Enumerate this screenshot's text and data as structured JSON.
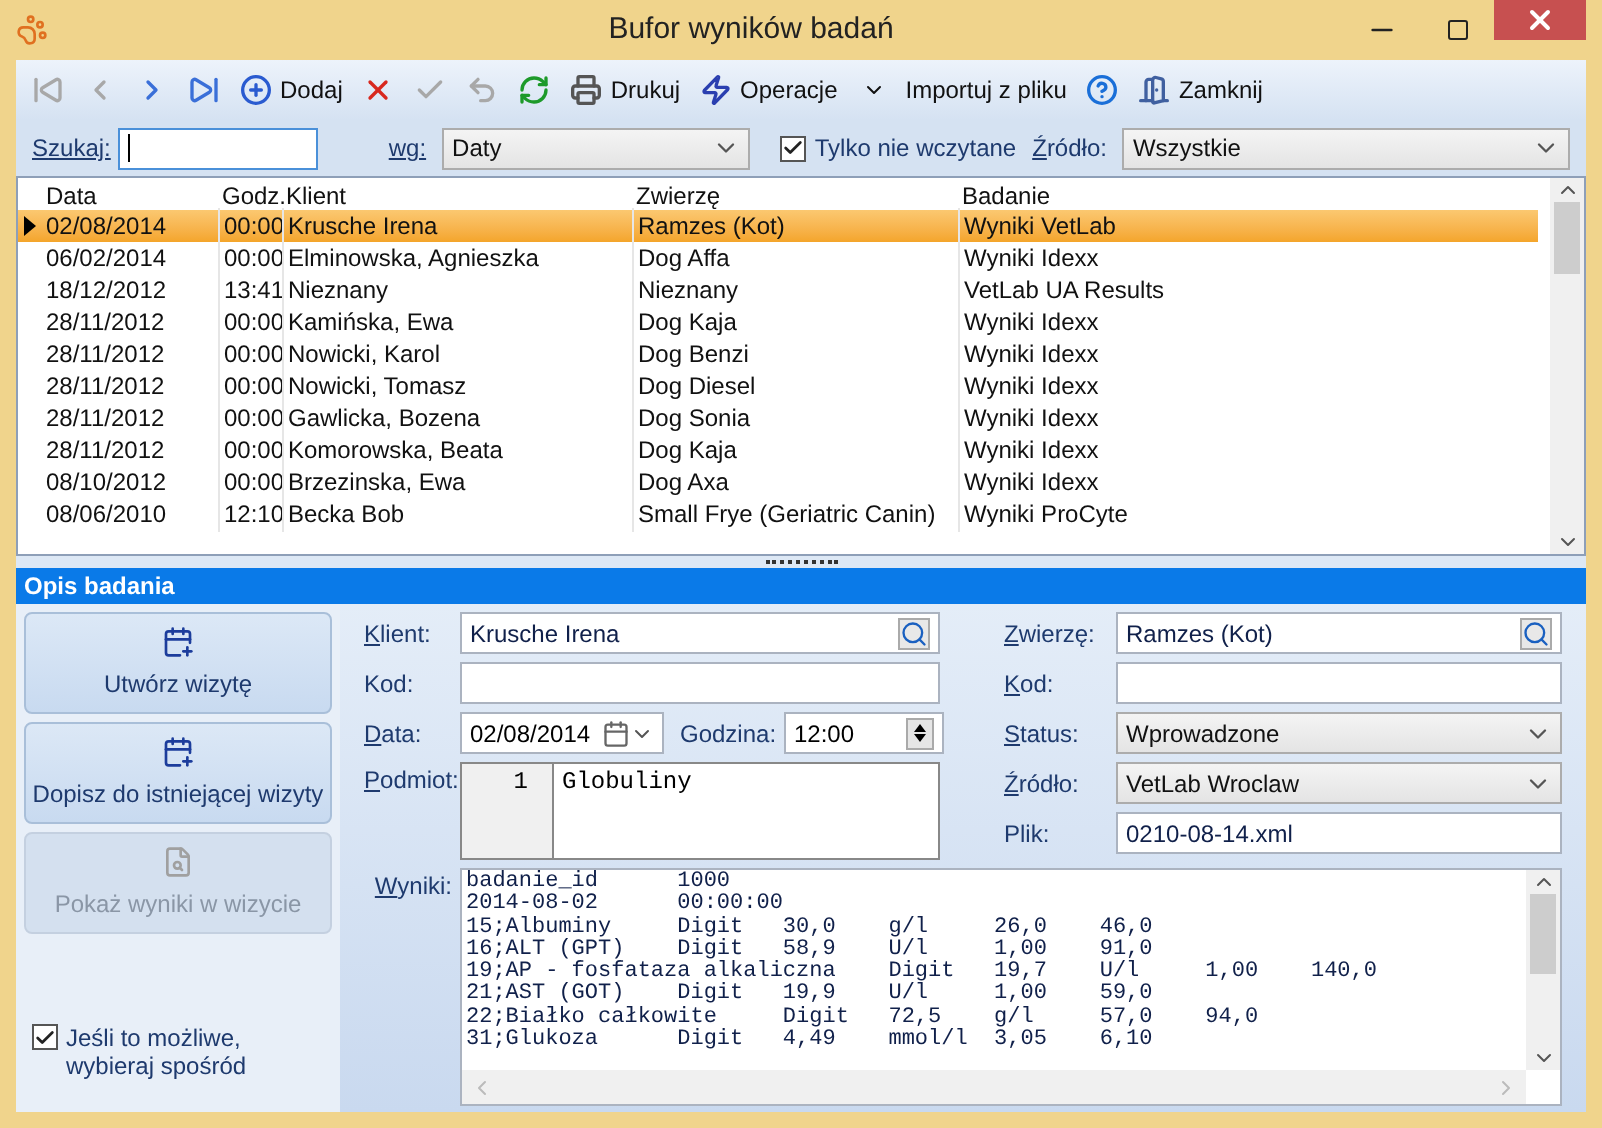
{
  "window": {
    "title": "Bufor wyników badań"
  },
  "toolbar": [
    {
      "kind": "first",
      "disabled": true
    },
    {
      "kind": "prev",
      "disabled": true
    },
    {
      "kind": "next",
      "disabled": false
    },
    {
      "kind": "last",
      "disabled": false
    },
    {
      "kind": "add",
      "label": "Dodaj",
      "disabled": false
    },
    {
      "kind": "delete",
      "disabled": false
    },
    {
      "kind": "accept",
      "disabled": true
    },
    {
      "kind": "undo",
      "disabled": true
    },
    {
      "kind": "refresh",
      "disabled": false
    },
    {
      "kind": "print",
      "label": "Drukuj",
      "disabled": false
    },
    {
      "kind": "operations",
      "label": "Operacje",
      "disabled": false
    },
    {
      "kind": "import",
      "label": "Importuj z pliku",
      "disabled": false
    },
    {
      "kind": "help",
      "disabled": false
    },
    {
      "kind": "close",
      "label": "Zamknij",
      "disabled": false
    }
  ],
  "filter": {
    "search_label": "Szukaj:",
    "by_label": "wg:",
    "by_value": "Daty",
    "only_new": {
      "label": "Tylko nie wczytane",
      "checked": true
    },
    "source_label": "Źródło:",
    "source_value": "Wszystkie"
  },
  "table": {
    "columns": [
      "Data",
      "Godz.",
      "Klient",
      "Zwierzę",
      "Badanie"
    ],
    "rows": [
      {
        "cells": [
          "02/08/2014",
          "00:00",
          "Krusche Irena",
          "Ramzes (Kot)",
          "Wyniki VetLab"
        ],
        "selected": true
      },
      {
        "cells": [
          "06/02/2014",
          "00:00",
          "Elminowska, Agnieszka",
          "Dog Affa",
          "Wyniki Idexx"
        ],
        "selected": false
      },
      {
        "cells": [
          "18/12/2012",
          "13:41",
          "Nieznany",
          "Nieznany",
          "VetLab UA Results"
        ],
        "selected": false
      },
      {
        "cells": [
          "28/11/2012",
          "00:00",
          "Kamińska, Ewa",
          "Dog Kaja",
          "Wyniki Idexx"
        ],
        "selected": false
      },
      {
        "cells": [
          "28/11/2012",
          "00:00",
          "Nowicki, Karol",
          "Dog Benzi",
          "Wyniki Idexx"
        ],
        "selected": false
      },
      {
        "cells": [
          "28/11/2012",
          "00:00",
          "Nowicki, Tomasz",
          "Dog Diesel",
          "Wyniki Idexx"
        ],
        "selected": false
      },
      {
        "cells": [
          "28/11/2012",
          "00:00",
          "Gawlicka, Bozena",
          "Dog Sonia",
          "Wyniki Idexx"
        ],
        "selected": false
      },
      {
        "cells": [
          "28/11/2012",
          "00:00",
          "Komorowska, Beata",
          "Dog Kaja",
          "Wyniki Idexx"
        ],
        "selected": false
      },
      {
        "cells": [
          "08/10/2012",
          "00:00",
          "Brzezinska, Ewa",
          "Dog Axa",
          "Wyniki Idexx"
        ],
        "selected": false
      },
      {
        "cells": [
          "08/06/2010",
          "12:10",
          "Becka Bob",
          "Small Frye (Geriatric Canin)",
          "Wyniki ProCyte"
        ],
        "selected": false
      }
    ]
  },
  "details": {
    "title": "Opis badania",
    "actions": [
      {
        "label": "Utwórz wizytę",
        "disabled": false
      },
      {
        "label": "Dopisz do istniejącej wizyty",
        "disabled": false
      },
      {
        "label": "Pokaż wyniki w wizycie",
        "disabled": true
      }
    ],
    "prefer": {
      "label": "Jeśli to możliwe, wybieraj spośród",
      "checked": true
    },
    "client_label": "Klient:",
    "client_value": "Krusche Irena",
    "code_label": "Kod:",
    "date_label": "Data:",
    "date_value": "02/08/2014",
    "time_label": "Godzina:",
    "time_value": "12:00",
    "subject_label": "Podmiot:",
    "subject_line_number": "1",
    "subject_value": "Globuliny",
    "animal_label": "Zwierzę:",
    "animal_value": "Ramzes (Kot)",
    "animal_code_label": "Kod:",
    "status_label": "Status:",
    "status_value": "Wprowadzone",
    "source_label": "Źródło:",
    "source_value": "VetLab Wroclaw",
    "file_label": "Plik:",
    "file_value": "0210-08-14.xml",
    "results_label": "Wyniki:",
    "results_lines": [
      "badanie_id      1000",
      "2014-08-02      00:00:00",
      "15;Albuminy     Digit   30,0    g/l     26,0    46,0",
      "16;ALT (GPT)    Digit   58,9    U/l     1,00    91,0",
      "19;AP - fosfataza alkaliczna    Digit   19,7    U/l     1,00    140,0",
      "21;AST (GOT)    Digit   19,9    U/l     1,00    59,0",
      "22;Białko całkowite     Digit   72,5    g/l     57,0    94,0",
      "31;Glukoza      Digit   4,49    mmol/l  3,05    6,10"
    ]
  }
}
